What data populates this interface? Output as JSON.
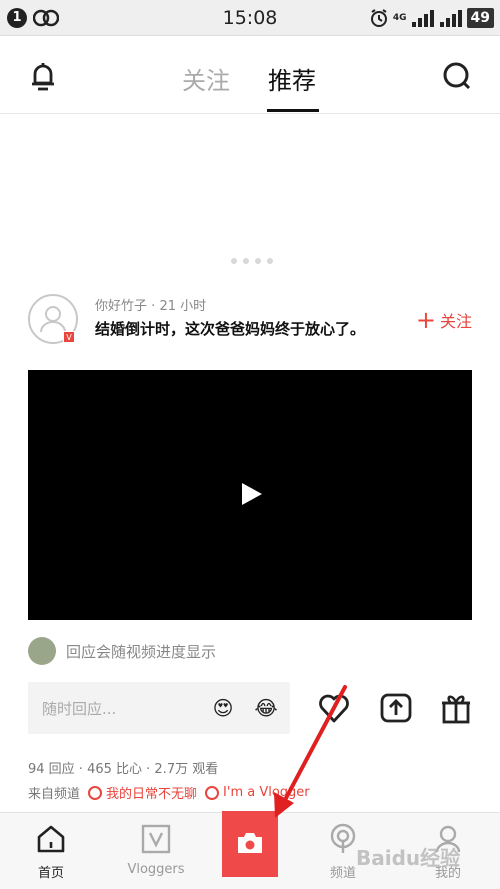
{
  "status_bar": {
    "notification_count": "1",
    "time": "15:08",
    "network_label": "4G",
    "battery": "49"
  },
  "header": {
    "tabs": [
      {
        "label": "关注",
        "active": false
      },
      {
        "label": "推荐",
        "active": true
      }
    ]
  },
  "banner": {
    "page_dots": 4,
    "active_dot": 0
  },
  "post": {
    "author": "你好竹子",
    "time_ago": "21 小时",
    "meta_separator": "·",
    "title": "结婚倒计时，这次爸爸妈妈终于放心了。",
    "verified_badge": "V",
    "follow_label": "关注",
    "follow_plus": "+",
    "danmu_text": "回应会随视频进度显示",
    "comment_placeholder": "随时回应...",
    "emoji_1": "😍",
    "emoji_2": "😂",
    "stats": "94 回应 · 465 比心 · 2.7万 观看",
    "from_channel_label": "来自频道",
    "channels": [
      "我的日常不无聊",
      "I'm a Vlogger"
    ]
  },
  "bottom_nav": {
    "items": [
      {
        "label": "首页",
        "icon": "home-icon",
        "active": true
      },
      {
        "label": "Vloggers",
        "icon": "vloggers-icon",
        "active": false
      },
      {
        "label": "频道",
        "icon": "channels-icon",
        "active": false
      },
      {
        "label": "我的",
        "icon": "profile-icon",
        "active": false
      }
    ],
    "center_icon": "camera-icon"
  },
  "colors": {
    "accent": "#e8453c",
    "camera": "#f0494a",
    "annotation_arrow": "#e02020"
  },
  "watermark": "Baidu经验"
}
